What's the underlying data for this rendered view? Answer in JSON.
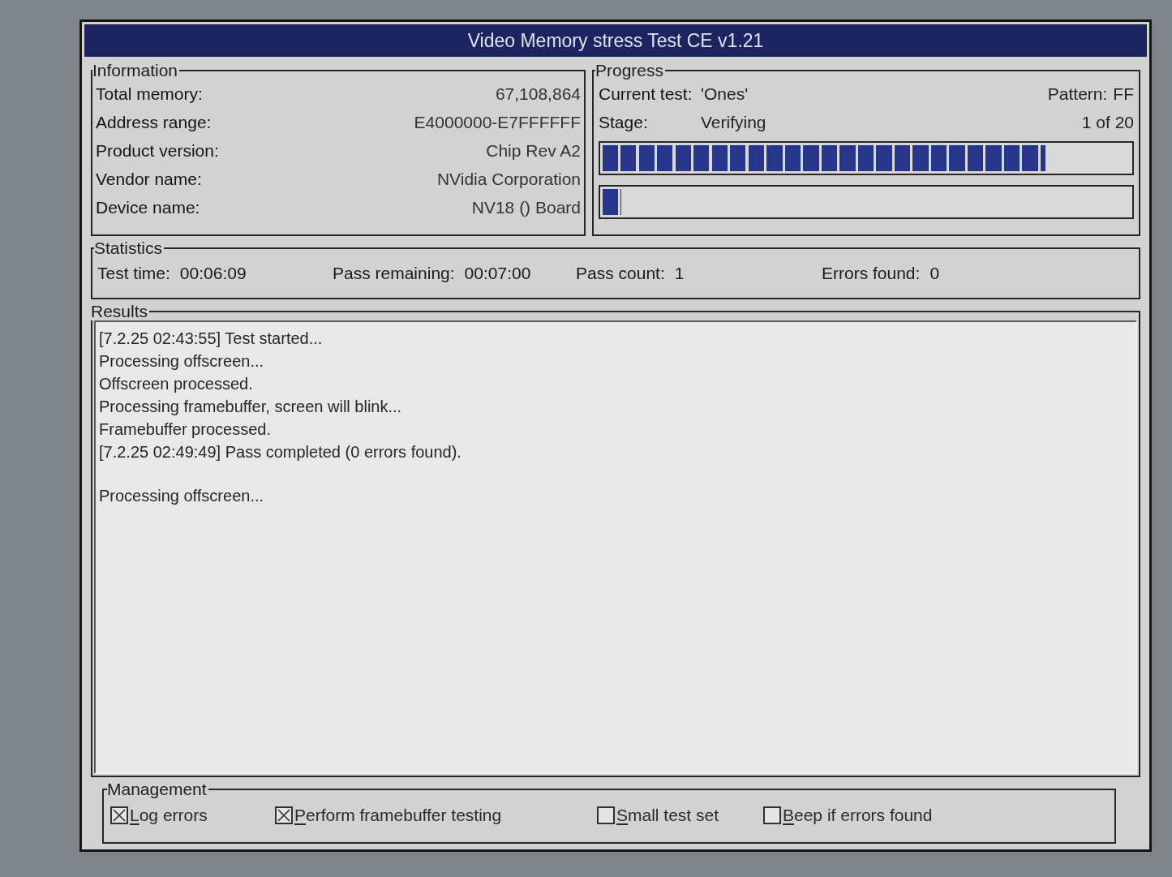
{
  "window": {
    "title": "Video Memory stress Test CE v1.21"
  },
  "information": {
    "title": "Information",
    "rows": [
      {
        "label": "Total memory:",
        "value": "67,108,864"
      },
      {
        "label": "Address range:",
        "value": "E4000000-E7FFFFFF"
      },
      {
        "label": "Product version:",
        "value": "Chip Rev A2"
      },
      {
        "label": "Vendor name:",
        "value": "NVidia Corporation"
      },
      {
        "label": "Device name:",
        "value": "NV18 () Board"
      }
    ]
  },
  "progress": {
    "title": "Progress",
    "current_test": {
      "label": "Current test:",
      "value": "'Ones'"
    },
    "pattern": {
      "label": "Pattern:",
      "value": "FF"
    },
    "stage": {
      "label": "Stage:",
      "value": "Verifying"
    },
    "stage_count": "1 of 20",
    "bars": [
      {
        "level": 0.84
      },
      {
        "level": 0.035
      }
    ]
  },
  "statistics": {
    "title": "Statistics",
    "items": [
      {
        "label": "Test time:",
        "value": "00:06:09"
      },
      {
        "label": "Pass remaining:",
        "value": "00:07:00"
      },
      {
        "label": "Pass count:",
        "value": "1"
      },
      {
        "label": "Errors found:",
        "value": "0"
      }
    ]
  },
  "results": {
    "title": "Results",
    "blocks": [
      {
        "lines": [
          "[7.2.25 02:43:55] Test started...",
          "Processing offscreen...",
          "Offscreen processed.",
          "Processing framebuffer, screen will blink...",
          "Framebuffer processed.",
          "[7.2.25 02:49:49] Pass completed (0 errors found)."
        ]
      },
      {
        "lines": [
          "Processing offscreen..."
        ]
      }
    ]
  },
  "management": {
    "title": "Management",
    "options": [
      {
        "label": "Log errors",
        "checked": true,
        "mnemonic": true
      },
      {
        "label": "Perform framebuffer testing",
        "checked": true,
        "mnemonic": true
      },
      {
        "label": "Small test set",
        "checked": false,
        "mnemonic": true
      },
      {
        "label": "Beep if errors found",
        "checked": false,
        "mnemonic": true
      }
    ]
  }
}
